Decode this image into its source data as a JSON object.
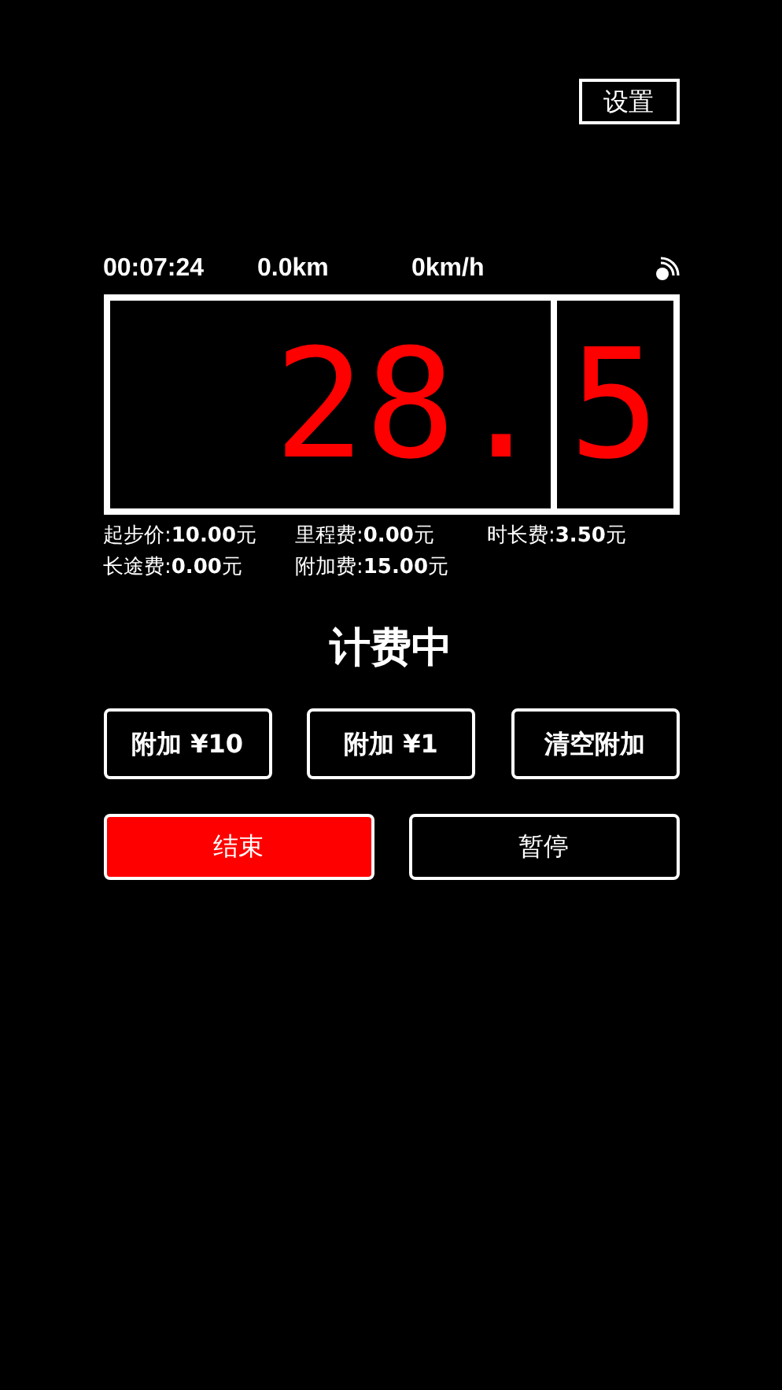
{
  "settings_button": "设置",
  "info": {
    "time": "00:07:24",
    "distance": "0.0km",
    "speed": "0km/h"
  },
  "display": {
    "main": "28.",
    "fraction": "5"
  },
  "fees": [
    "起步价:**10.00**元",
    "里程费:**0.00**元",
    "时长费:**3.50**元",
    "长途费:**0.00**元",
    "附加费:**15.00**元"
  ],
  "status": "计费中",
  "surcharge_buttons": [
    "附加 ¥10",
    "附加 ¥1",
    "清空附加"
  ],
  "actions": [
    {
      "label": "结束",
      "kind": "primary"
    },
    {
      "label": "暂停",
      "kind": "outline"
    }
  ]
}
